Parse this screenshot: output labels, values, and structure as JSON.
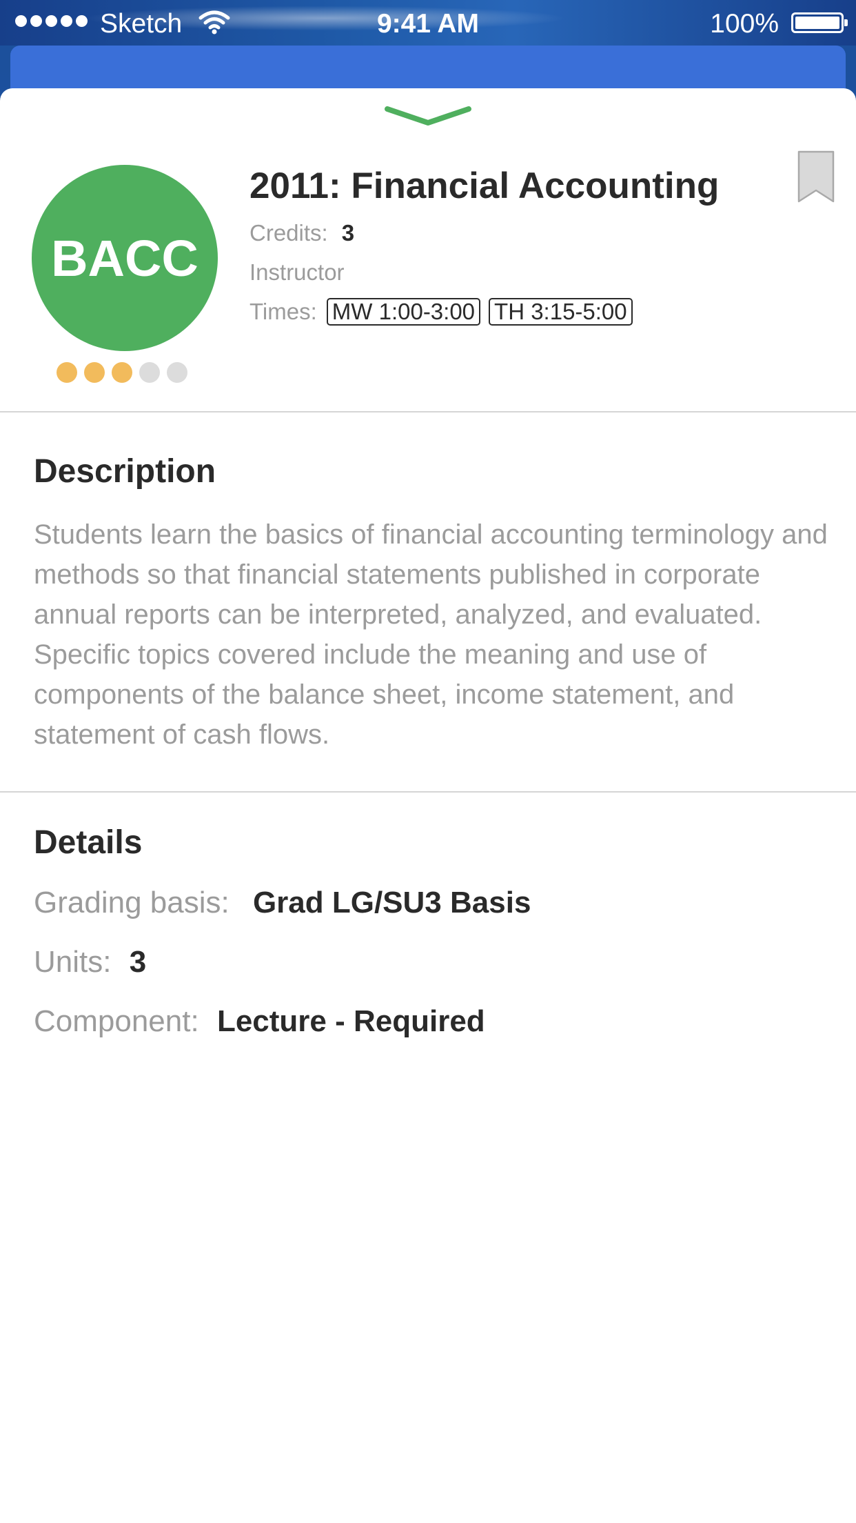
{
  "status_bar": {
    "carrier": "Sketch",
    "time": "9:41 AM",
    "battery": "100%",
    "icons": [
      "signal-dots-icon",
      "wifi-icon",
      "battery-icon"
    ]
  },
  "course": {
    "code_badge": "BACC",
    "title": "2011: Financial Accounting",
    "credits_label": "Credits:",
    "credits_value": "3",
    "instructor_label": "Instructor",
    "times_label": "Times:",
    "times": [
      "MW 1:00-3:00",
      "TH 3:15-5:00"
    ],
    "rating": {
      "filled": 3,
      "total": 5
    }
  },
  "description": {
    "heading": "Description",
    "text": "Students learn the basics of financial accounting terminology and methods so that financial statements published in corporate annual reports can be interpreted, analyzed, and evaluated.  Specific topics covered include the meaning and use of components of the balance sheet, income statement, and statement of cash flows."
  },
  "details": {
    "heading": "Details",
    "grading_label": "Grading basis:",
    "grading_value": "Grad LG/SU3 Basis",
    "units_label": "Units:",
    "units_value": "3",
    "component_label": "Component:",
    "component_value": "Lecture - Required"
  },
  "colors": {
    "badge_green": "#4faf5e",
    "grabber_green": "#4faf5e",
    "rating_filled": "#f2bb5c",
    "rating_empty": "#dcdcdc",
    "header_blue": "#3a6fd8"
  }
}
